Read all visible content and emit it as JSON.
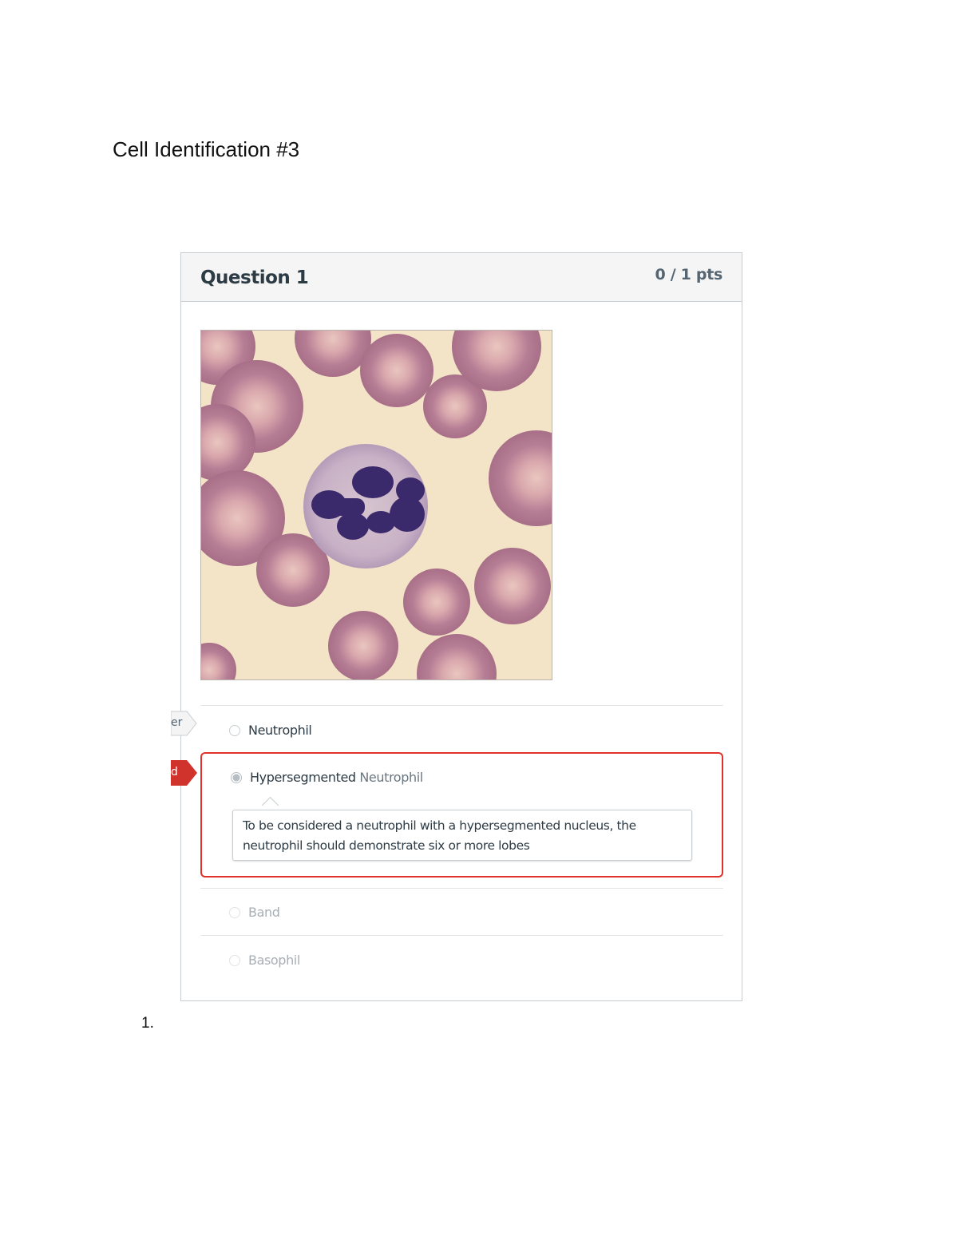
{
  "document": {
    "title": "Cell Identification #3",
    "list_number": "1."
  },
  "question": {
    "title": "Question 1",
    "points": "0 / 1 pts",
    "image_alt": "Blood smear micrograph showing a neutrophil surrounded by red blood cells"
  },
  "answers": [
    {
      "label": "Neutrophil",
      "selected": false,
      "muted": false
    },
    {
      "label_bold": "Hypersegmented",
      "label_rest": " Neutrophil",
      "selected": true,
      "muted": false
    },
    {
      "label": "Band",
      "selected": false,
      "muted": true
    },
    {
      "label": "Basophil",
      "selected": false,
      "muted": true
    }
  ],
  "feedback": {
    "comment": "To be considered a neutrophil with a hypersegmented nucleus, the neutrophil should demonstrate six or more lobes"
  },
  "flags": {
    "correct_answer_fragment": "er",
    "you_answered_fragment": "d"
  },
  "colors": {
    "selected_border": "#e0322b",
    "you_answered_flag": "#d0332c",
    "header_bg": "#f5f5f5",
    "text_primary": "#2d3b45",
    "text_muted": "#a7afb5"
  }
}
